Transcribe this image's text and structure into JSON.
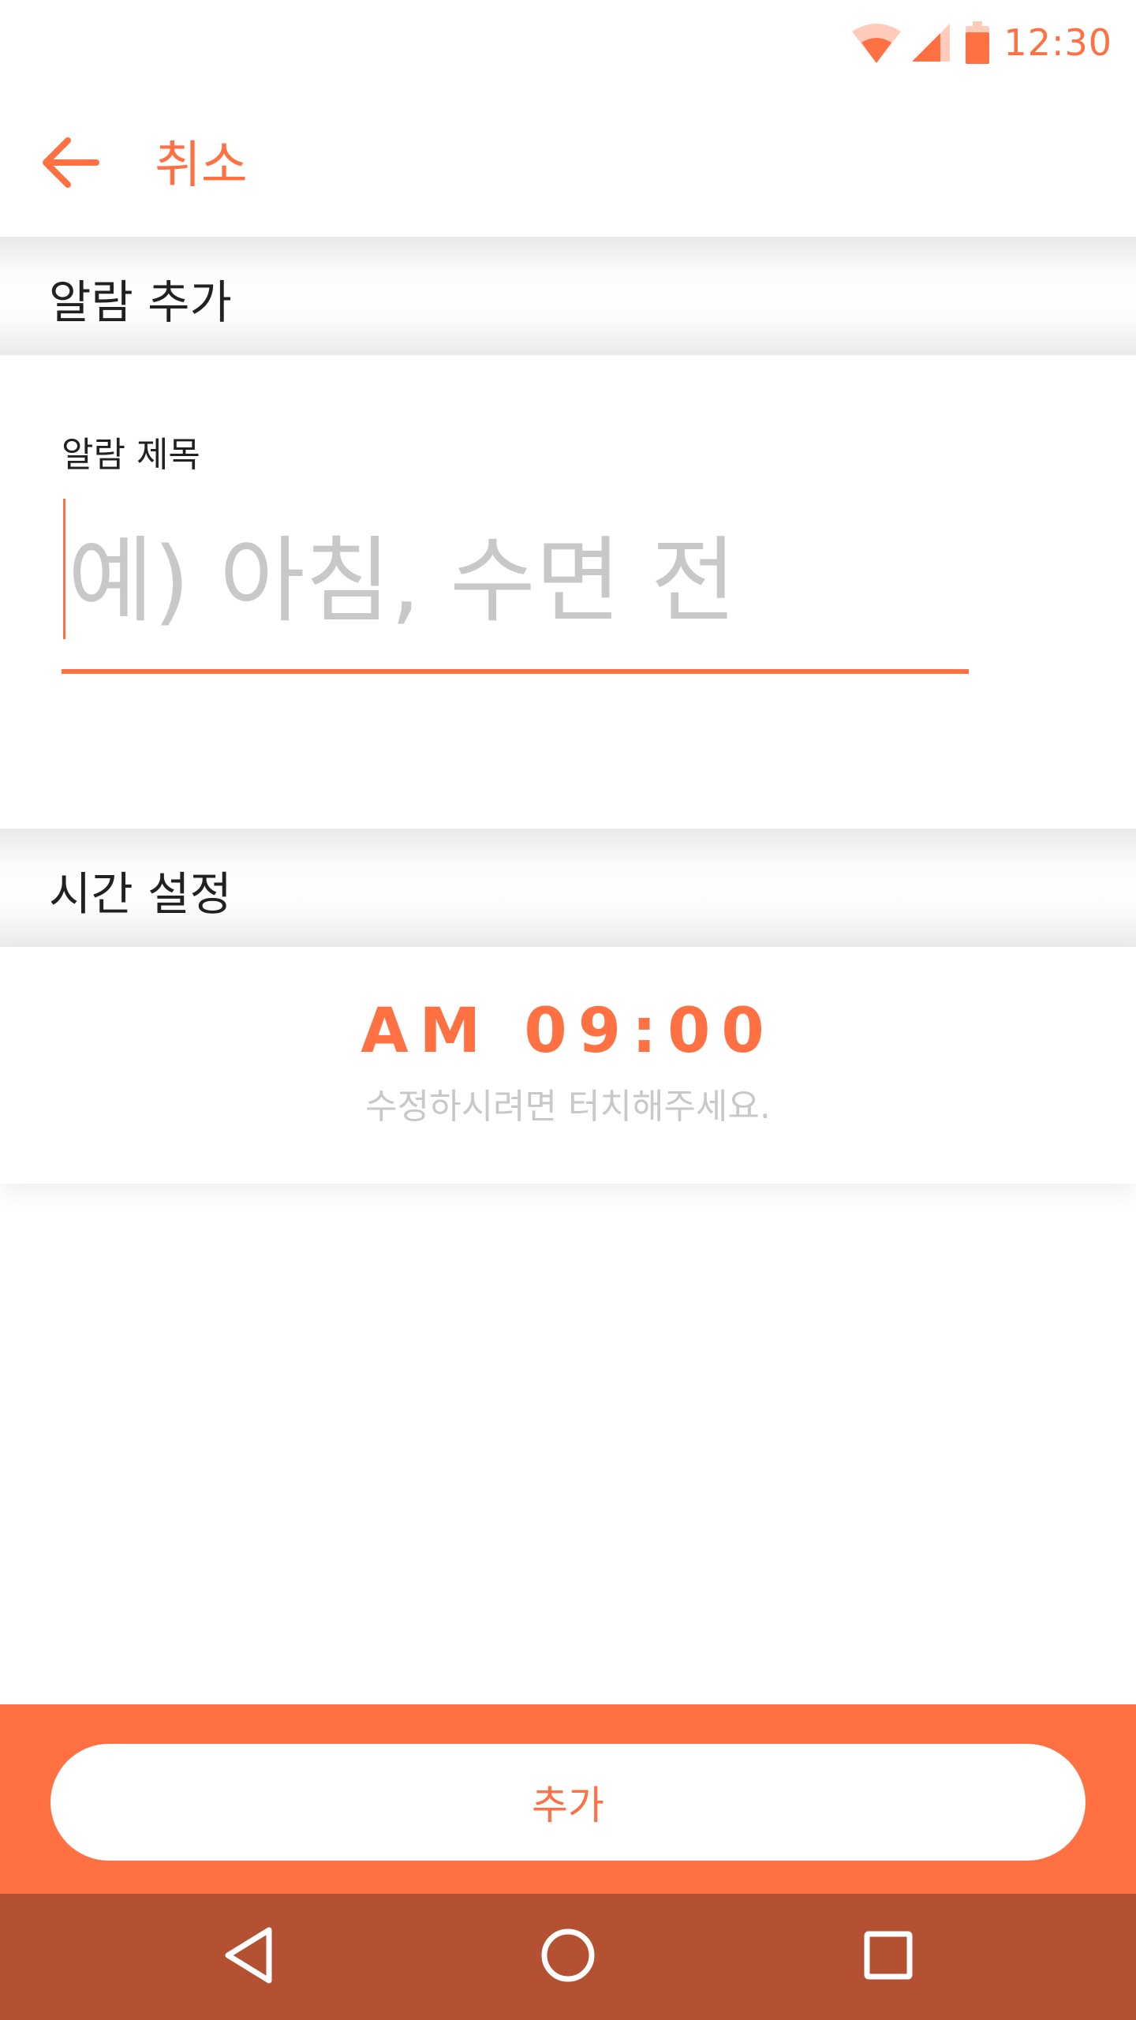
{
  "status_bar": {
    "time": "12:30",
    "icons": [
      "wifi-icon",
      "signal-icon",
      "battery-icon"
    ]
  },
  "app_bar": {
    "back_icon": "arrow-left-icon",
    "cancel_label": "취소"
  },
  "sections": {
    "add_alarm_title": "알람 추가",
    "time_setting_title": "시간 설정"
  },
  "title_field": {
    "label": "알람 제목",
    "value": "",
    "placeholder": "예) 아침, 수면 전"
  },
  "time_picker": {
    "time": "AM 09:00",
    "hint": "수정하시려면 터치해주세요."
  },
  "bottom": {
    "add_label": "추가"
  },
  "nav_bar": {
    "icons": [
      "back-triangle-icon",
      "home-circle-icon",
      "recents-square-icon"
    ]
  },
  "colors": {
    "accent": "#FF7043",
    "nav_bar": "#B45133",
    "placeholder": "#C8C8C8",
    "text": "#212121"
  }
}
